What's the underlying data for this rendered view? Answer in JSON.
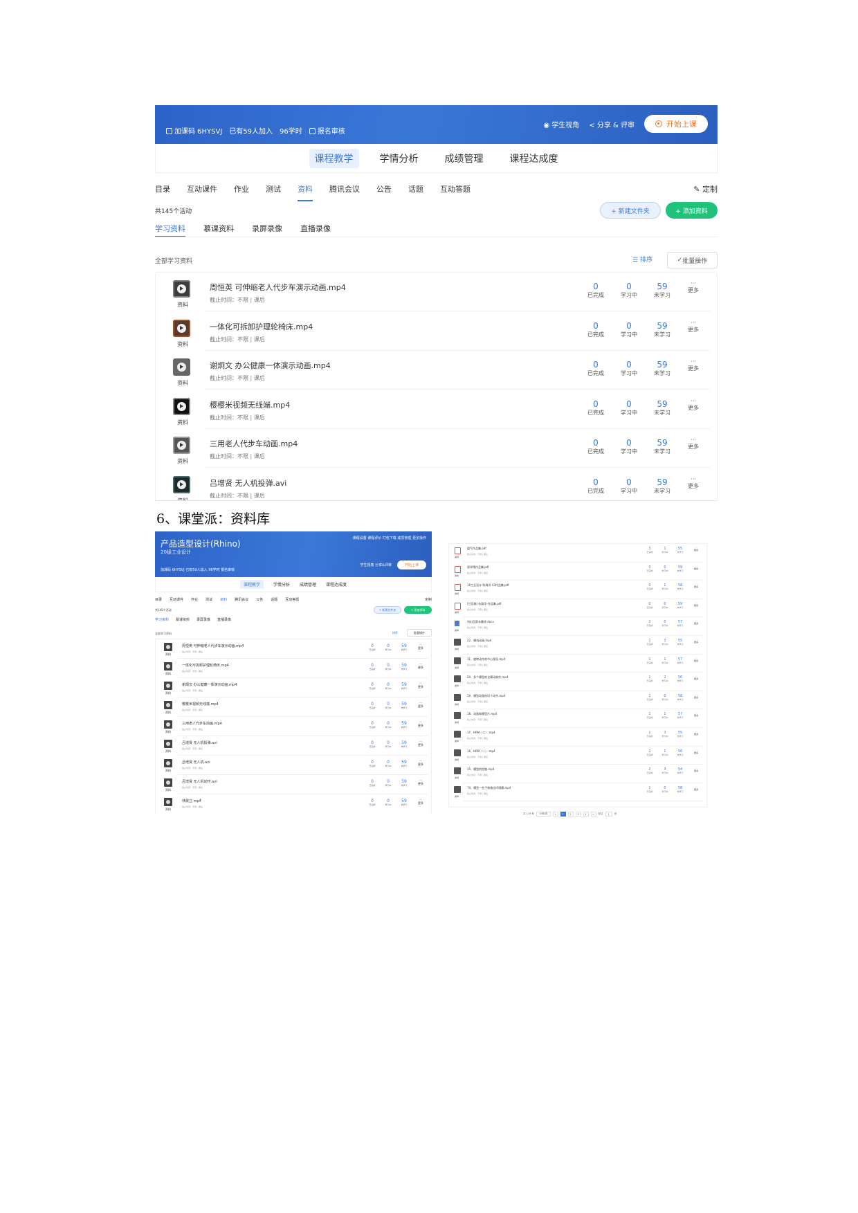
{
  "main": {
    "banner": {
      "join_code_label": "加课码 6HYSVJ",
      "joined": "已有59人加入",
      "hours": "96学时",
      "signup_review": "报名审核",
      "student_view": "学生视角",
      "share": "分享 & 评审",
      "start_class": "开始上课"
    },
    "tabs": [
      "课程教学",
      "学情分析",
      "成绩管理",
      "课程达成度"
    ],
    "subnav": [
      "目录",
      "互动课件",
      "作业",
      "测试",
      "资料",
      "腾讯会议",
      "公告",
      "话题",
      "互动答题"
    ],
    "customize": "定制",
    "activity_count": "共145个活动",
    "new_folder": "+ 新建文件夹",
    "add_resource": "+ 添加资料",
    "resource_tabs": [
      "学习资料",
      "慕课资料",
      "录屏录像",
      "直播录像"
    ],
    "all_label": "全部学习资料",
    "sort": "排序",
    "batch": "批量操作",
    "stat_labels": {
      "done": "已完成",
      "learning": "学习中",
      "not": "未学习"
    },
    "more_dots": "···",
    "more_label": "更多",
    "rows": [
      {
        "label": "资料",
        "title": "周恒英 可伸缩老人代步车演示动画.mp4",
        "meta": "截止时间：不限  |  课后",
        "done": "0",
        "learning": "0",
        "not": "59"
      },
      {
        "label": "资料",
        "title": "一体化可拆卸护理轮椅床.mp4",
        "meta": "截止时间：不限  |  课后",
        "done": "0",
        "learning": "0",
        "not": "59"
      },
      {
        "label": "资料",
        "title": "谢炯文 办公健康一体演示动画.mp4",
        "meta": "截止时间：不限  |  课后",
        "done": "0",
        "learning": "0",
        "not": "59"
      },
      {
        "label": "资料",
        "title": "樱樱米视频无线端.mp4",
        "meta": "截止时间：不限  |  课后",
        "done": "0",
        "learning": "0",
        "not": "59"
      },
      {
        "label": "资料",
        "title": "三用老人代步车动画.mp4",
        "meta": "截止时间：不限  |  课后",
        "done": "0",
        "learning": "0",
        "not": "59"
      },
      {
        "label": "资料",
        "title": "吕增贤 无人机投弹.avi",
        "meta": "截止时间：不限  |  课后",
        "done": "0",
        "learning": "0",
        "not": "59"
      }
    ]
  },
  "caption": "6、课堂派：资料库",
  "thumb_a": {
    "course_title": "产品造型设计(Rhino)",
    "class_name": "20级工业设计",
    "top_actions": "课程设置  课程评价  打包下载  成员管理  更多操作",
    "info": "加课码 6HYSVJ  已有59人加入  96学时  报名审核",
    "roles": "学生视角  分享&评审",
    "start": "开始上课",
    "tabs": [
      "课程教学",
      "学情分析",
      "成绩管理",
      "课程达成度"
    ],
    "subnav": [
      "目录",
      "互动课件",
      "作业",
      "测试",
      "资料",
      "腾讯会议",
      "公告",
      "话题",
      "互动答题"
    ],
    "customize": "定制",
    "count": "共145个活动",
    "new_folder": "+ 新建文件夹",
    "add": "+ 添加资料",
    "resource_tabs": [
      "学习资料",
      "慕课资料",
      "录屏录像",
      "直播录像"
    ],
    "all_label": "全部学习资料",
    "sort": "排序",
    "batch": "批量操作",
    "rows": [
      {
        "title": "周恒英 可伸缩老人代步车演示动画.mp4",
        "done": "0",
        "learning": "0",
        "not": "59"
      },
      {
        "title": "一体化可拆卸护理轮椅床.mp4",
        "done": "0",
        "learning": "0",
        "not": "59"
      },
      {
        "title": "谢炯文 办公健康一体演示动画.mp4",
        "done": "0",
        "learning": "0",
        "not": "59"
      },
      {
        "title": "樱樱米视频无线端.mp4",
        "done": "0",
        "learning": "0",
        "not": "59"
      },
      {
        "title": "三用老人代步车动画.mp4",
        "done": "0",
        "learning": "0",
        "not": "59"
      },
      {
        "title": "吕增贤 无人机投弹.avi",
        "done": "0",
        "learning": "0",
        "not": "59"
      },
      {
        "title": "吕增贤 无人机.avi",
        "done": "0",
        "learning": "0",
        "not": "59"
      },
      {
        "title": "吕增贤 无人机动作.avi",
        "done": "0",
        "learning": "0",
        "not": "59"
      },
      {
        "title": "林晨立.mp4",
        "done": "0",
        "learning": "0",
        "not": "59"
      }
    ]
  },
  "thumb_b": {
    "rows": [
      {
        "title": "煤气作品集.pdf",
        "done": "3",
        "learning": "1",
        "not": "55"
      },
      {
        "title": "邪学德作品集.pdf",
        "done": "0",
        "learning": "0",
        "not": "59"
      },
      {
        "title": "16工业设计-陈海洋 43作品集.pdf",
        "done": "0",
        "learning": "1",
        "not": "58"
      },
      {
        "title": "(已压缩) 杜颖华-作品集.pdf",
        "done": "0",
        "learning": "0",
        "not": "59"
      },
      {
        "title": "刘幻回家未最终.docx",
        "done": "2",
        "learning": "0",
        "not": "57"
      },
      {
        "title": "22、模机动画.mp4",
        "done": "1",
        "learning": "3",
        "not": "55"
      },
      {
        "title": "31、旋转动作的中心指导.mp4",
        "done": "1",
        "learning": "1",
        "not": "57"
      },
      {
        "title": "20、多个模型的全模动制作.mp4",
        "done": "1",
        "learning": "2",
        "not": "56"
      },
      {
        "title": "19、模型动画的切个动作.mp4",
        "done": "1",
        "learning": "0",
        "not": "58"
      },
      {
        "title": "18、动画和模型片.mp4",
        "done": "1",
        "learning": "1",
        "not": "57"
      },
      {
        "title": "17、HRM（二）.mp4",
        "done": "1",
        "learning": "3",
        "not": "55"
      },
      {
        "title": "16、HRM（一）.mp4",
        "done": "2",
        "learning": "1",
        "not": "56"
      },
      {
        "title": "15、模型的控制.mp4",
        "done": "2",
        "learning": "3",
        "not": "54"
      },
      {
        "title": "74、模型一些子和指位环境模.mp4",
        "done": "1",
        "learning": "0",
        "not": "58"
      }
    ],
    "pager": {
      "total": "共 128 条",
      "size": "10条/页",
      "pages": [
        "1",
        "2",
        "3",
        "4"
      ],
      "goto": "前往",
      "goto_page": "1",
      "suffix": "页"
    }
  }
}
